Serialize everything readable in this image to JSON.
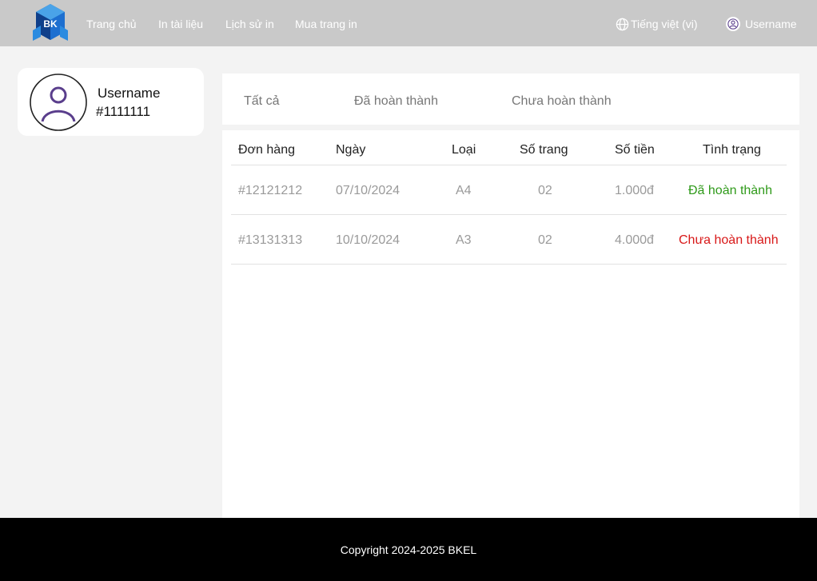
{
  "header": {
    "logo_text": "BK",
    "nav": [
      "Trang chủ",
      "In tài liệu",
      "Lịch sử in",
      "Mua trang in"
    ],
    "language": "Tiếng việt (vi)",
    "username": "Username"
  },
  "profile": {
    "name": "Username",
    "id": "#1111111"
  },
  "tabs": [
    "Tất cả",
    "Đã hoàn thành",
    "Chưa hoàn thành"
  ],
  "table": {
    "columns": [
      "Đơn hàng",
      "Ngày",
      "Loại",
      "Số trang",
      "Số tiền",
      "Tình trạng"
    ],
    "rows": [
      {
        "order": "#12121212",
        "date": "07/10/2024",
        "type": "A4",
        "pages": "02",
        "amount": "1.000đ",
        "status": "Đã hoàn thành"
      },
      {
        "order": "#13131313",
        "date": "10/10/2024",
        "type": "A3",
        "pages": "02",
        "amount": "4.000đ",
        "status": "Chưa hoàn thành"
      }
    ]
  },
  "colors": {
    "header_bg": "#c9c9c9",
    "page_bg": "#f3f3f3",
    "logo_blue": "#1a5fb4",
    "status_done": "#2f9a1a",
    "status_pending": "#d81818",
    "avatar_purple": "#5a3e8c"
  },
  "icons": {
    "globe": "globe-icon",
    "user": "user-icon",
    "avatar": "avatar-icon"
  },
  "footer": {
    "copyright": "Copyright 2024-2025 BKEL"
  }
}
